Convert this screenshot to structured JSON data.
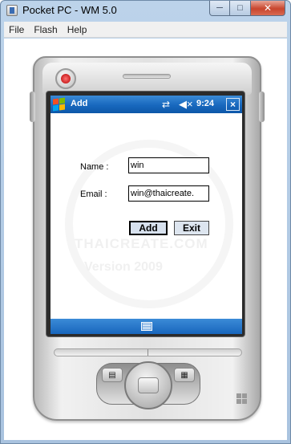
{
  "window": {
    "title": "Pocket PC - WM 5.0",
    "minimize_glyph": "─",
    "maximize_glyph": "□",
    "close_glyph": "✕"
  },
  "menu": {
    "items": [
      "File",
      "Flash",
      "Help"
    ]
  },
  "device_screen": {
    "app_title": "Add",
    "time": "9:24",
    "connectivity_glyph": "⇄",
    "volume_glyph": "◀×",
    "close_label": "×"
  },
  "form": {
    "name_label": "Name :",
    "name_value": "win",
    "email_label": "Email :",
    "email_value": "win@thaicreate.",
    "add_button": "Add",
    "exit_button": "Exit"
  },
  "watermark": {
    "text_1": "THAICREATE.COM",
    "text_2": "Version 2009"
  },
  "hardware_buttons": {
    "left_glyph": "▤",
    "right_glyph": "▦"
  },
  "icons": {
    "power": "power-icon",
    "keyboard": "keyboard-icon",
    "start": "windows-start-icon"
  }
}
